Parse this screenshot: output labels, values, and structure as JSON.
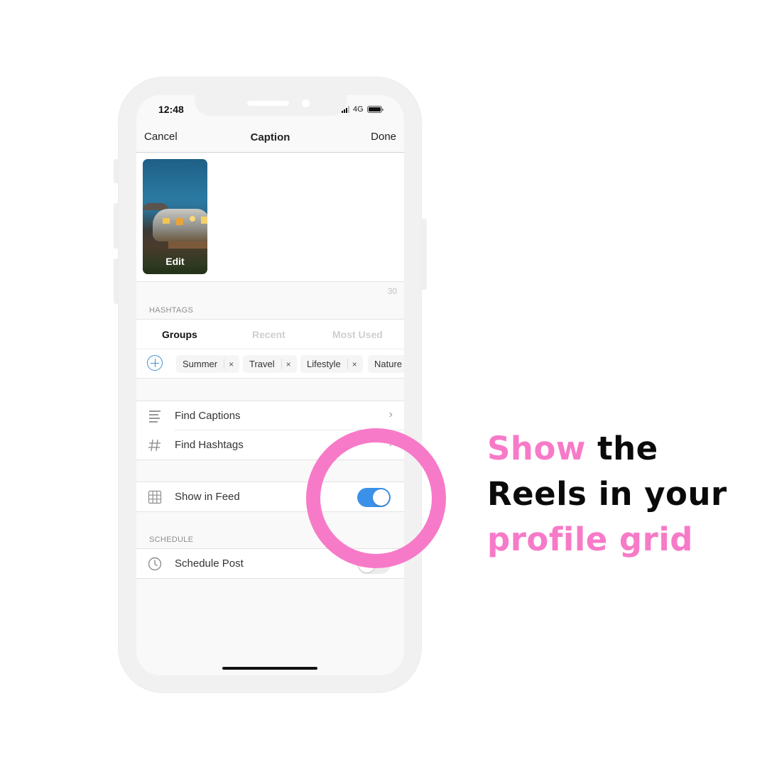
{
  "status_bar": {
    "time": "12:48",
    "network": "4G",
    "signal_icon": "signal-bars-icon",
    "battery_icon": "battery-full-icon"
  },
  "nav": {
    "cancel_label": "Cancel",
    "title": "Caption",
    "done_label": "Done"
  },
  "caption": {
    "thumbnail_alt": "Airstream trailer at dusk with people sitting outside",
    "edit_label": "Edit",
    "character_count": "30"
  },
  "hashtags": {
    "section_label": "HASHTAGS",
    "tabs": [
      {
        "label": "Groups",
        "active": true
      },
      {
        "label": "Recent",
        "active": false
      },
      {
        "label": "Most Used",
        "active": false
      }
    ],
    "add_icon": "add-circle-icon",
    "chips": [
      {
        "label": "Summer",
        "remove": "×"
      },
      {
        "label": "Travel",
        "remove": "×"
      },
      {
        "label": "Lifestyle",
        "remove": "×"
      },
      {
        "label": "Nature",
        "remove": "×"
      }
    ]
  },
  "tools": {
    "items": [
      {
        "label": "Find Captions",
        "icon": "text-lines-icon",
        "chevron": "›"
      },
      {
        "label": "Find Hashtags",
        "icon": "hashtag-icon",
        "chevron": "›"
      }
    ]
  },
  "feed": {
    "show_in_feed_label": "Show in Feed",
    "icon": "grid-icon",
    "show_in_feed_on": true
  },
  "schedule": {
    "section_label": "SCHEDULE",
    "schedule_post_label": "Schedule Post",
    "icon": "clock-icon",
    "schedule_on": false
  },
  "headline": {
    "line1_pink": "Show",
    "line1_black": "the",
    "line2_black": "Reels in your",
    "line3_pink": "profile grid"
  },
  "colors": {
    "accent_pink": "#f77ac8",
    "toggle_blue": "#3b91e8",
    "add_icon_blue": "#3f8fd0"
  }
}
